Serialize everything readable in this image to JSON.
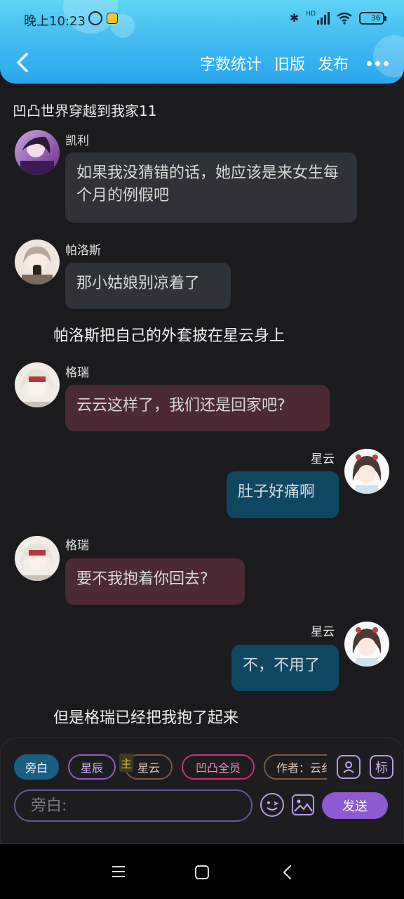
{
  "status": {
    "time": "晚上10:23",
    "network": "HD",
    "battery": "36",
    "battery_fraction": 0.36
  },
  "header": {
    "word_count": "字数统计",
    "old_version": "旧版",
    "publish": "发布"
  },
  "chapter_title": "凹凸世界穿越到我家11",
  "messages": [
    {
      "name": "凯利",
      "text": "如果我没猜错的话，她应该是来女生每个月的例假吧"
    },
    {
      "name": "帕洛斯",
      "text": "那小姑娘别凉着了"
    },
    {
      "narration": "帕洛斯把自己的外套披在星云身上"
    },
    {
      "name": "格瑞",
      "text": "云云这样了，我们还是回家吧?"
    },
    {
      "name": "星云",
      "text": "肚子好痛啊"
    },
    {
      "name": "格瑞",
      "text": "要不我抱着你回去?"
    },
    {
      "name": "星云",
      "text": "不，不用了"
    },
    {
      "narration": "但是格瑞已经把我抱了起来"
    }
  ],
  "composer": {
    "chips": [
      "旁白",
      "星辰",
      "星云",
      "凹凸全员",
      "作者：云纟"
    ],
    "host_badge": "主",
    "mark_label": "标",
    "placeholder": "旁白:",
    "send": "发送"
  },
  "colors": {
    "header_top": "#5fd3f6",
    "header_bottom": "#2aa6ee",
    "bubble_gray": "#2f3238",
    "bubble_red": "#4c2a33",
    "bubble_blue": "#0f4763",
    "send": "#8e59d1"
  }
}
